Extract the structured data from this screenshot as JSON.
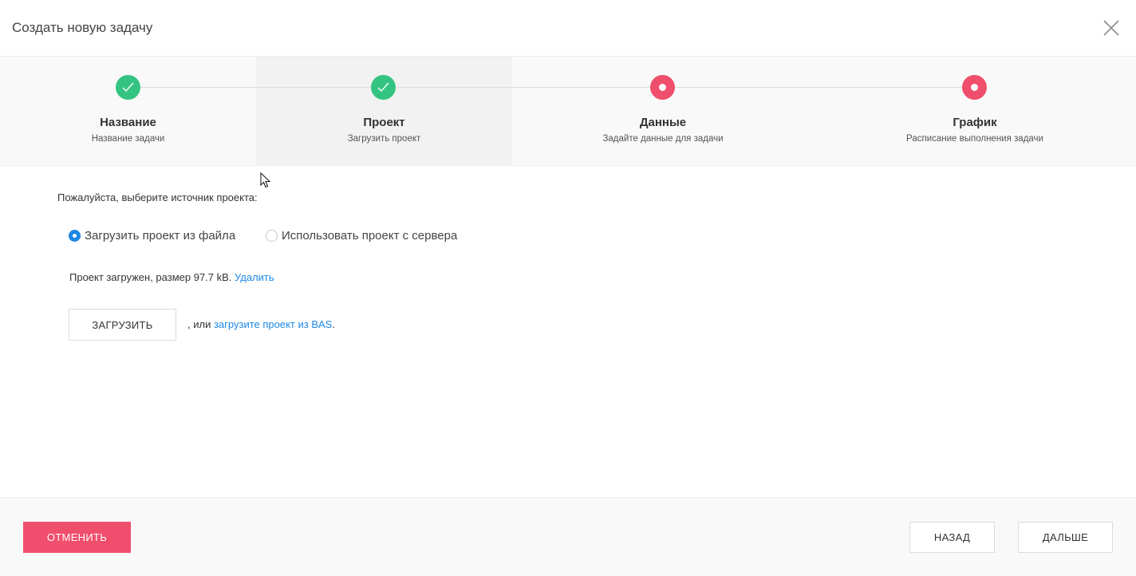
{
  "header": {
    "title": "Создать новую задачу"
  },
  "steps": [
    {
      "label": "Название",
      "sub": "Название задачи",
      "state": "done"
    },
    {
      "label": "Проект",
      "sub": "Загрузить проект",
      "state": "done",
      "active": true
    },
    {
      "label": "Данные",
      "sub": "Задайте данные для задачи",
      "state": "todo"
    },
    {
      "label": "График",
      "sub": "Расписание выполнения задачи",
      "state": "todo"
    }
  ],
  "content": {
    "prompt": "Пожалуйста, выберите источник проекта:",
    "radio_file": "Загрузить проект из файла",
    "radio_server": "Использовать проект с сервера",
    "selected_source": "file",
    "status_text": "Проект загружен, размер 97.7 kB.",
    "delete_link": "Удалить",
    "upload_button": "ЗАГРУЗИТЬ",
    "or_text": ", или",
    "bas_link": "загрузите проект из BAS",
    "bas_suffix": "."
  },
  "footer": {
    "cancel": "ОТМЕНИТЬ",
    "back": "НАЗАД",
    "next": "ДАЛЬШЕ"
  },
  "colors": {
    "done": "#33c481",
    "todo": "#ef4e6c",
    "link": "#1e88e5",
    "cancel_bg": "#ef4e6c"
  }
}
